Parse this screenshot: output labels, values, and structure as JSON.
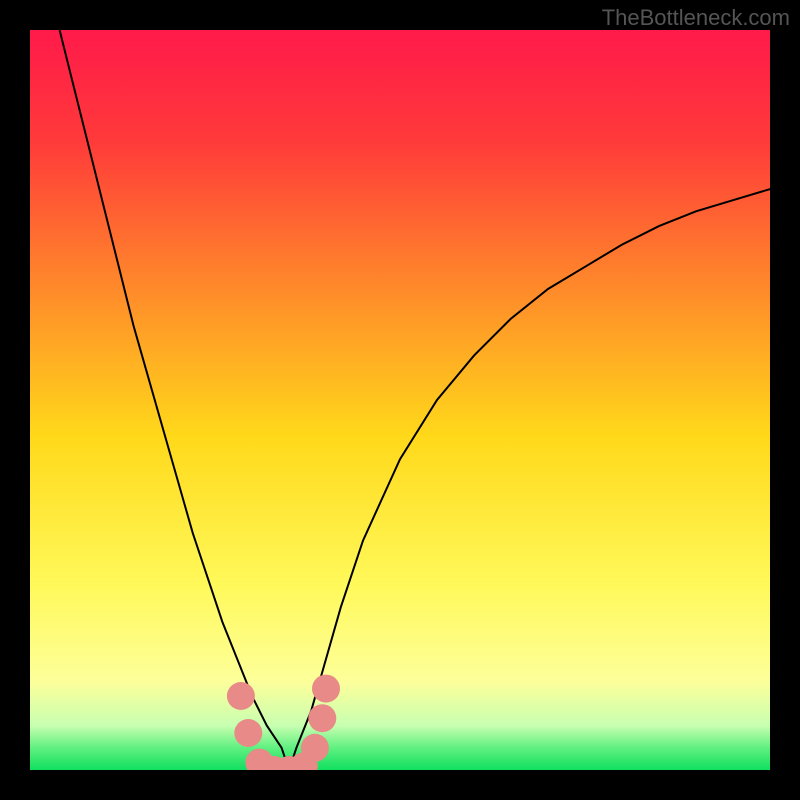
{
  "watermark": "TheBottleneck.com",
  "chart_data": {
    "type": "line",
    "title": "",
    "xlabel": "",
    "ylabel": "",
    "xlim": [
      0,
      100
    ],
    "ylim": [
      0,
      100
    ],
    "background_gradient": {
      "stops": [
        {
          "offset": 0.0,
          "color": "#ff1a4a"
        },
        {
          "offset": 0.15,
          "color": "#ff3a3a"
        },
        {
          "offset": 0.35,
          "color": "#ff8a2a"
        },
        {
          "offset": 0.55,
          "color": "#ffd91a"
        },
        {
          "offset": 0.75,
          "color": "#fff95a"
        },
        {
          "offset": 0.88,
          "color": "#fdff9a"
        },
        {
          "offset": 0.94,
          "color": "#c8ffb0"
        },
        {
          "offset": 0.97,
          "color": "#60f080"
        },
        {
          "offset": 1.0,
          "color": "#10e060"
        }
      ]
    },
    "series": [
      {
        "name": "curve",
        "type": "line",
        "color": "#000000",
        "stroke_width": 2,
        "x": [
          4,
          6,
          8,
          10,
          12,
          14,
          16,
          18,
          20,
          22,
          24,
          26,
          28,
          30,
          32,
          34,
          35,
          36,
          38,
          40,
          42,
          45,
          50,
          55,
          60,
          65,
          70,
          75,
          80,
          85,
          90,
          95,
          100
        ],
        "y": [
          100,
          92,
          84,
          76,
          68,
          60,
          53,
          46,
          39,
          32,
          26,
          20,
          15,
          10,
          6,
          3,
          0,
          3,
          8,
          15,
          22,
          31,
          42,
          50,
          56,
          61,
          65,
          68,
          71,
          73.5,
          75.5,
          77,
          78.5
        ]
      },
      {
        "name": "marker-cluster",
        "type": "scatter",
        "color": "#e88a88",
        "marker_size": 14,
        "x": [
          28.5,
          29.5,
          31,
          33,
          35,
          37,
          38.5,
          39.5,
          40
        ],
        "y": [
          10,
          5,
          1,
          0,
          0,
          0.5,
          3,
          7,
          11
        ]
      }
    ]
  }
}
